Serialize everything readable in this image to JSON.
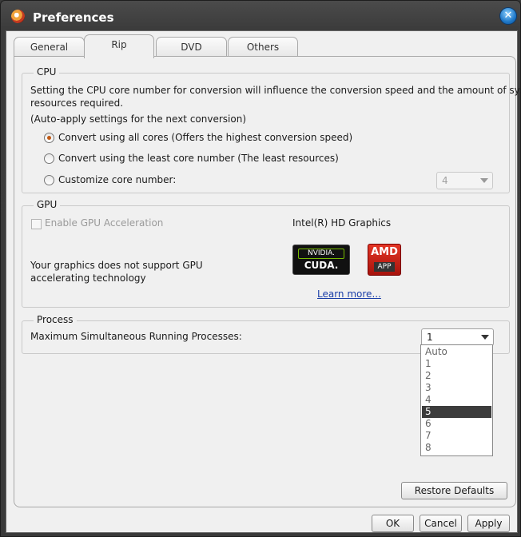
{
  "window": {
    "title": "Preferences"
  },
  "tabs": [
    "General",
    "Rip",
    "DVD",
    "Others"
  ],
  "cpu": {
    "title": "CPU",
    "desc1": "Setting the CPU core number for conversion will influence the conversion speed and the amount of system",
    "desc2": "resources required.",
    "note": "(Auto-apply settings for the next conversion)",
    "options": [
      "Convert using all cores (Offers the highest conversion speed)",
      "Convert using the least core number (The least resources)",
      "Customize core number:"
    ],
    "selected_option": 0,
    "core_value": "4"
  },
  "gpu": {
    "title": "GPU",
    "enable_label": "Enable GPU Acceleration",
    "device": "Intel(R) HD Graphics",
    "notice1": "Your graphics does not support GPU",
    "notice2": "accelerating technology",
    "nvidia_top": "NVIDIA.",
    "nvidia_bottom": "CUDA.",
    "amd_top": "AMD",
    "amd_bottom": "APP",
    "learn_more": "Learn more..."
  },
  "process": {
    "title": "Process",
    "label": "Maximum Simultaneous Running Processes:",
    "value": "1",
    "options": [
      "Auto",
      "1",
      "2",
      "3",
      "4",
      "5",
      "6",
      "7",
      "8"
    ],
    "highlighted": "5"
  },
  "buttons": {
    "restore": "Restore Defaults",
    "ok": "OK",
    "cancel": "Cancel",
    "apply": "Apply"
  },
  "colors": {
    "accent": "#c05a16",
    "link": "#1a3ea8",
    "titlebar": "#3c3c3c"
  }
}
